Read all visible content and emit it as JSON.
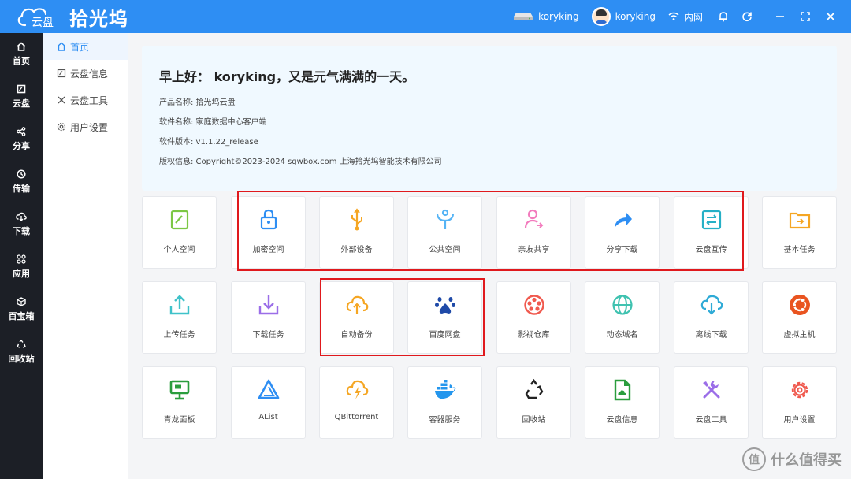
{
  "app": {
    "brand": "拾光坞",
    "logo_text": "云盘"
  },
  "topbar": {
    "device_name": "koryking",
    "user_name": "koryking",
    "network": "内网"
  },
  "rail": [
    {
      "label": "首页"
    },
    {
      "label": "云盘"
    },
    {
      "label": "分享"
    },
    {
      "label": "传输"
    },
    {
      "label": "下载"
    },
    {
      "label": "应用"
    },
    {
      "label": "百宝箱"
    },
    {
      "label": "回收站"
    }
  ],
  "subnav": [
    {
      "label": "首页"
    },
    {
      "label": "云盘信息"
    },
    {
      "label": "云盘工具"
    },
    {
      "label": "用户设置"
    }
  ],
  "info": {
    "greeting": "早上好： koryking，又是元气满满的一天。",
    "lines": [
      "产品名称: 拾光坞云盘",
      "软件名称: 家庭数据中心客户端",
      "软件版本: v1.1.22_release",
      "版权信息: Copyright©2023-2024 sgwbox.com 上海拾光坞智能技术有限公司"
    ]
  },
  "tiles": [
    {
      "label": "个人空间",
      "icon": "personal-space-icon",
      "color": "#7cc744"
    },
    {
      "label": "加密空间",
      "icon": "lock-icon",
      "color": "#2e8ef3"
    },
    {
      "label": "外部设备",
      "icon": "usb-icon",
      "color": "#f5a623"
    },
    {
      "label": "公共空间",
      "icon": "public-space-icon",
      "color": "#56b4f5"
    },
    {
      "label": "亲友共享",
      "icon": "share-user-icon",
      "color": "#f27bbd"
    },
    {
      "label": "分享下载",
      "icon": "share-arrow-icon",
      "color": "#2e8ef3"
    },
    {
      "label": "云盘互传",
      "icon": "transfer-icon",
      "color": "#26b0c6"
    },
    {
      "label": "基本任务",
      "icon": "task-folder-icon",
      "color": "#f5a623"
    },
    {
      "label": "上传任务",
      "icon": "upload-icon",
      "color": "#3fc2c9"
    },
    {
      "label": "下载任务",
      "icon": "download-icon",
      "color": "#9b6ee8"
    },
    {
      "label": "自动备份",
      "icon": "cloud-upload-icon",
      "color": "#f5a623"
    },
    {
      "label": "百度网盘",
      "icon": "baidu-icon",
      "color": "#1f4aa8"
    },
    {
      "label": "影视仓库",
      "icon": "film-reel-icon",
      "color": "#f05a4f"
    },
    {
      "label": "动态域名",
      "icon": "globe-icon",
      "color": "#3fc2b0"
    },
    {
      "label": "离线下载",
      "icon": "cloud-download-icon",
      "color": "#2eaad6"
    },
    {
      "label": "虚拟主机",
      "icon": "ubuntu-icon",
      "color": "#e95420"
    },
    {
      "label": "青龙面板",
      "icon": "panel-icon",
      "color": "#2a9d3d"
    },
    {
      "label": "AList",
      "icon": "alist-icon",
      "color": "#2e8ef3"
    },
    {
      "label": "QBittorrent",
      "icon": "qbittorrent-icon",
      "color": "#f5a623"
    },
    {
      "label": "容器服务",
      "icon": "docker-icon",
      "color": "#2496ed"
    },
    {
      "label": "回收站",
      "icon": "recycle-icon",
      "color": "#222222"
    },
    {
      "label": "云盘信息",
      "icon": "cloud-info-icon",
      "color": "#2a9d3d"
    },
    {
      "label": "云盘工具",
      "icon": "tools-icon",
      "color": "#9b6ee8"
    },
    {
      "label": "用户设置",
      "icon": "settings-gear-icon",
      "color": "#f05a4f"
    }
  ],
  "watermark": {
    "text": "什么值得买",
    "badge": "值"
  }
}
